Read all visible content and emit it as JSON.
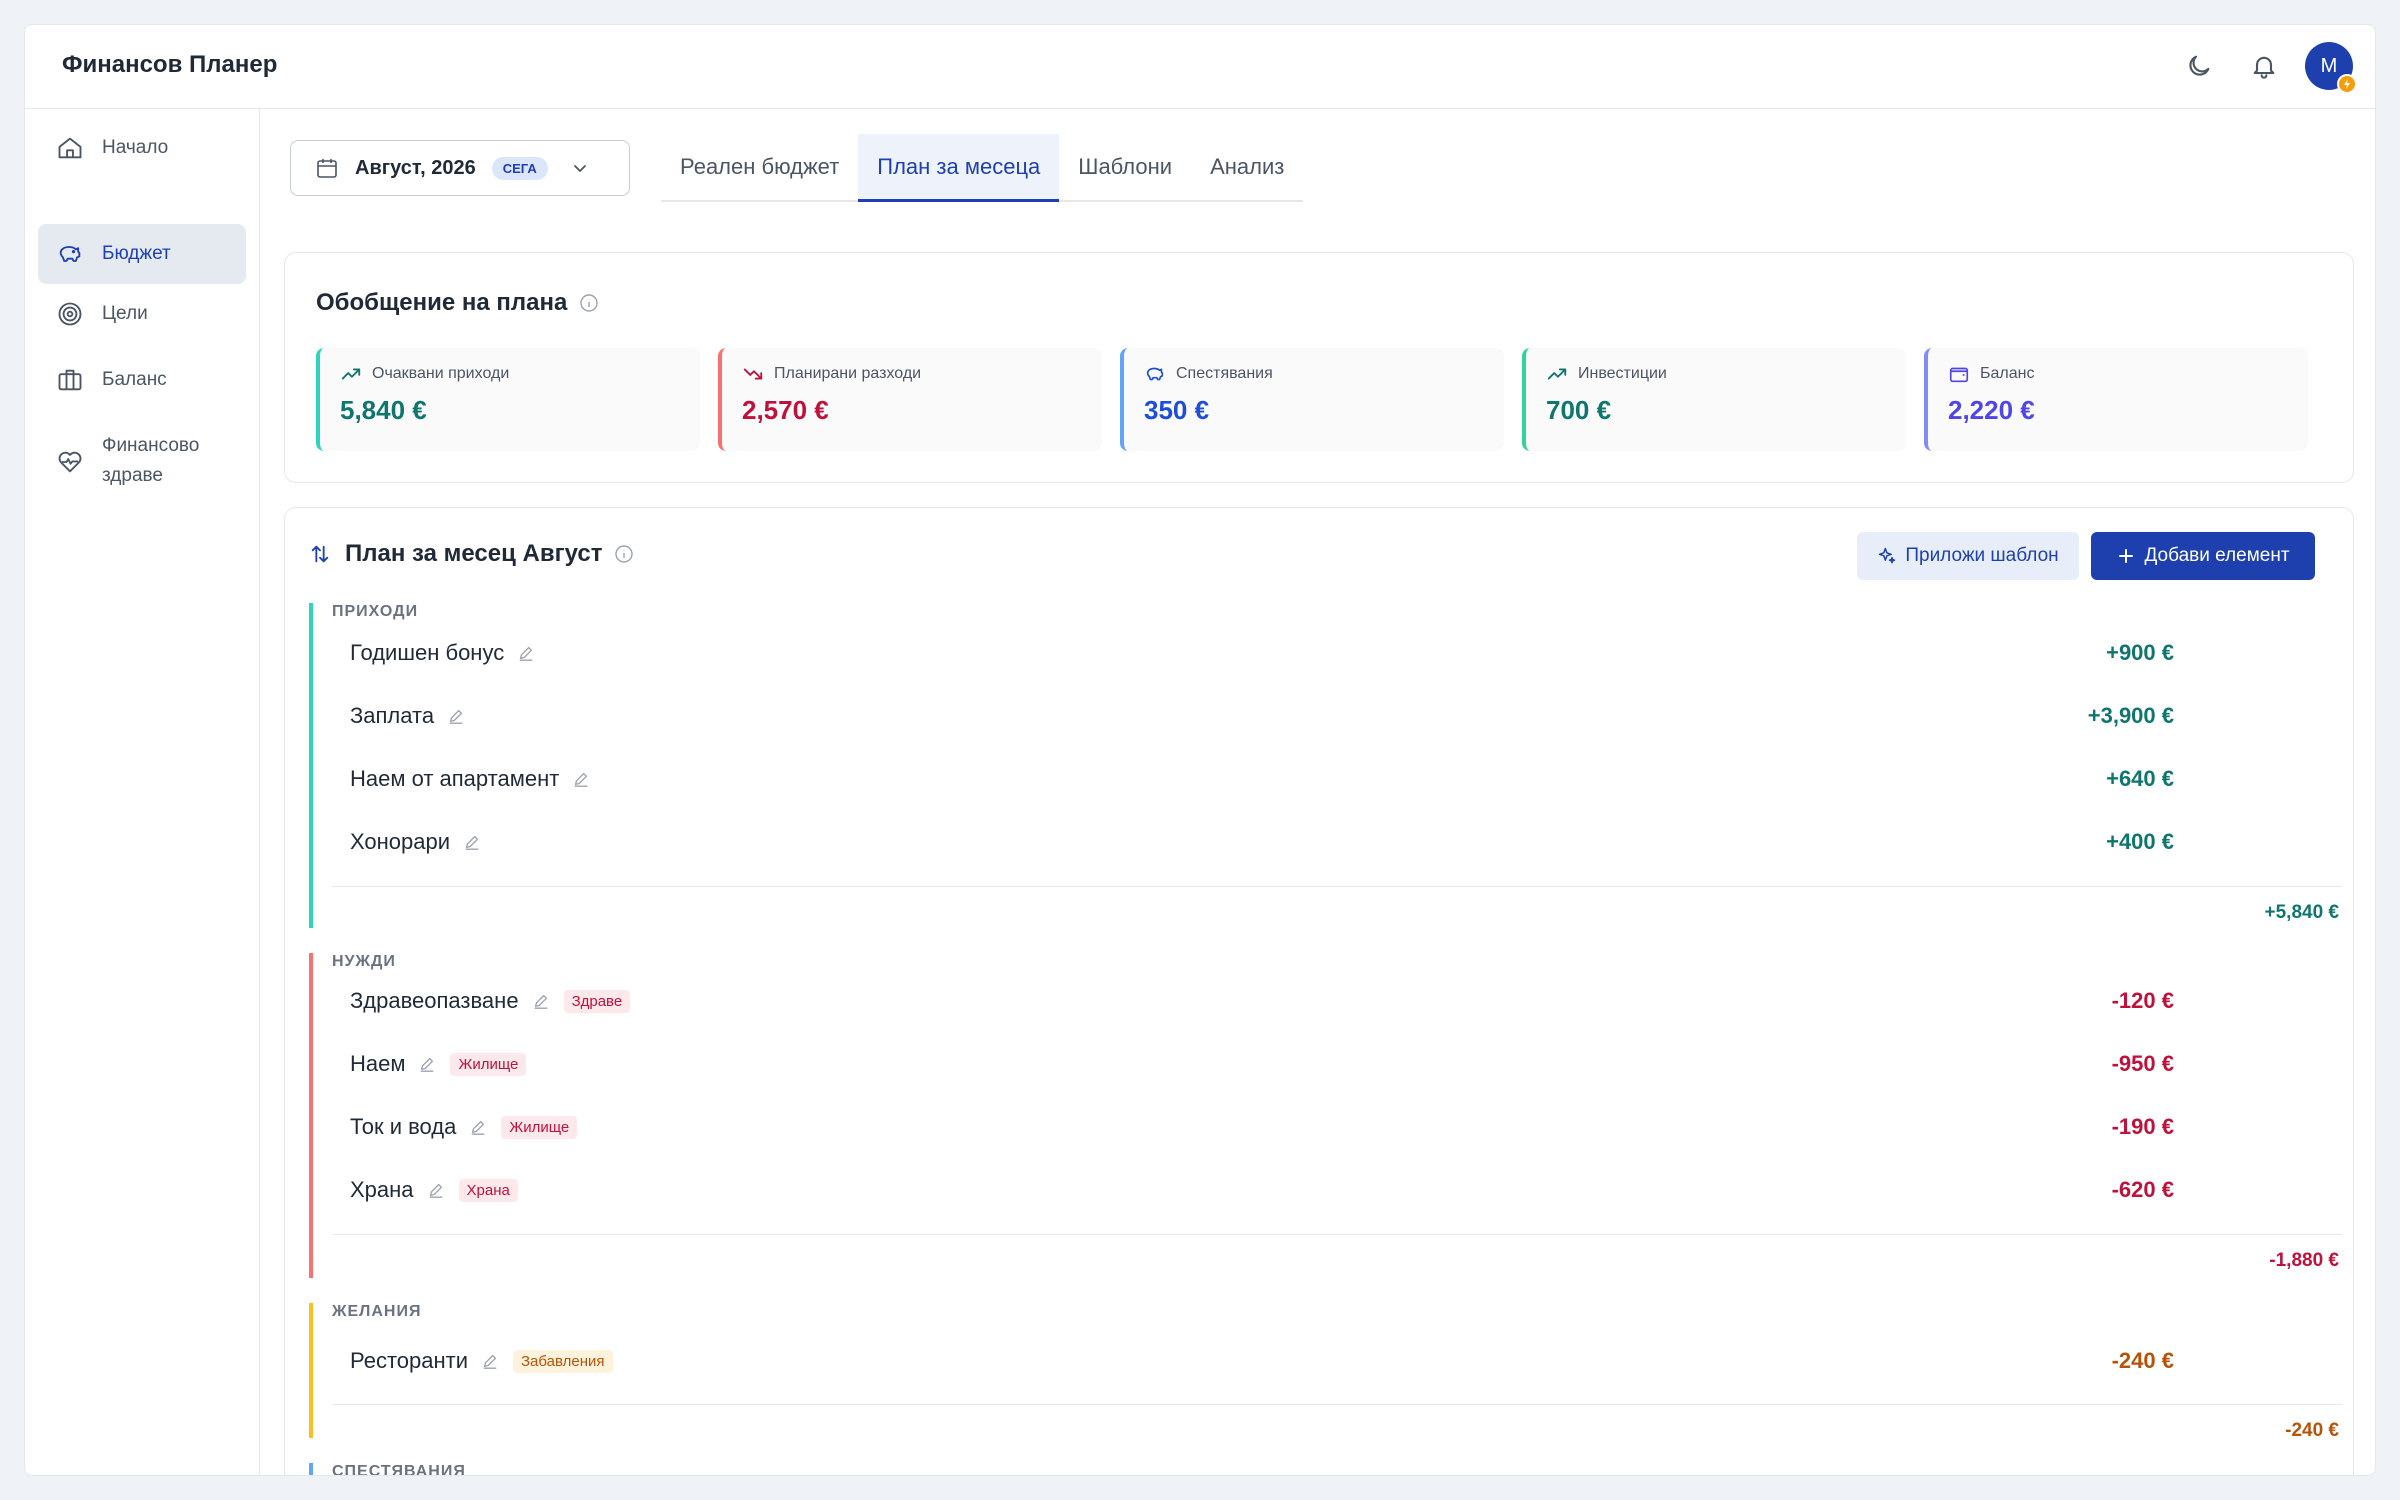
{
  "app": {
    "title": "Финансов Планер",
    "avatar_initial": "M"
  },
  "colors": {
    "primary": "#1e40af",
    "income": "#0f766e",
    "expense": "#be123c",
    "savings": "#1d4ed8",
    "balance": "#4f46e5",
    "wants": "#b45309"
  },
  "sidebar": {
    "items": [
      {
        "label": "Начало",
        "icon": "home-icon"
      },
      {
        "label": "Бюджет",
        "icon": "piggy-bank-icon",
        "active": true
      },
      {
        "label": "Цели",
        "icon": "target-icon"
      },
      {
        "label": "Баланс",
        "icon": "briefcase-icon"
      },
      {
        "label": "Финансово здраве",
        "icon": "heart-pulse-icon"
      }
    ]
  },
  "month_selector": {
    "value": "Август, 2026",
    "badge": "СЕГА"
  },
  "tabs": [
    {
      "label": "Реален бюджет"
    },
    {
      "label": "План за месеца",
      "active": true
    },
    {
      "label": "Шаблони"
    },
    {
      "label": "Анализ"
    }
  ],
  "summary": {
    "title": "Обобщение на плана",
    "stats": [
      {
        "label": "Очаквани приходи",
        "value": "5,840 €"
      },
      {
        "label": "Планирани разходи",
        "value": "2,570 €"
      },
      {
        "label": "Спестявания",
        "value": "350 €"
      },
      {
        "label": "Инвестиции",
        "value": "700 €"
      },
      {
        "label": "Баланс",
        "value": "2,220 €"
      }
    ]
  },
  "plan": {
    "title": "План за месец Август",
    "apply_template": "Приложи шаблон",
    "add_item": "Добави елемент",
    "groups": [
      {
        "label": "ПРИХОДИ",
        "total": "+5,840 €",
        "rows": [
          {
            "name": "Годишен бонус",
            "amount": "+900 €"
          },
          {
            "name": "Заплата",
            "amount": "+3,900 €"
          },
          {
            "name": "Наем от апартамент",
            "amount": "+640 €"
          },
          {
            "name": "Хонорари",
            "amount": "+400 €"
          }
        ]
      },
      {
        "label": "НУЖДИ",
        "total": "-1,880 €",
        "rows": [
          {
            "name": "Здравеопазване",
            "tag": "Здраве",
            "amount": "-120 €"
          },
          {
            "name": "Наем",
            "tag": "Жилище",
            "amount": "-950 €"
          },
          {
            "name": "Ток и вода",
            "tag": "Жилище",
            "amount": "-190 €"
          },
          {
            "name": "Храна",
            "tag": "Храна",
            "amount": "-620 €"
          }
        ]
      },
      {
        "label": "ЖЕЛАНИЯ",
        "total": "-240 €",
        "rows": [
          {
            "name": "Ресторанти",
            "tag": "Забавления",
            "amount": "-240 €"
          }
        ]
      },
      {
        "label": "СПЕСТЯВАНИЯ",
        "rows": []
      }
    ]
  }
}
